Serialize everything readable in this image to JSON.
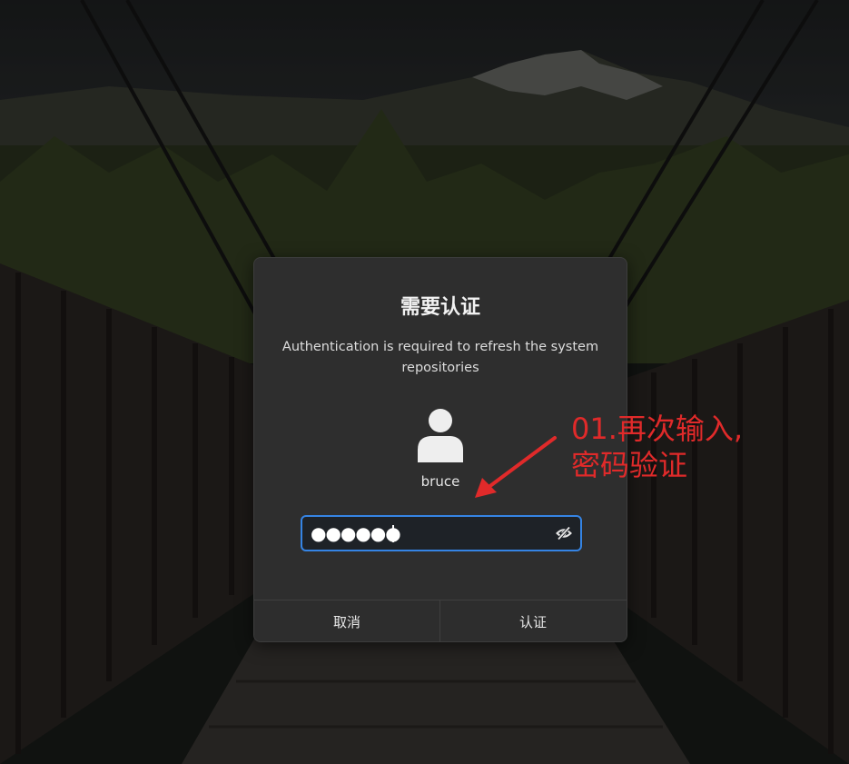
{
  "dialog": {
    "title": "需要认证",
    "message": "Authentication is required to refresh the system repositories",
    "user": {
      "name": "bruce",
      "avatar_icon": "user-avatar-icon"
    },
    "password_field": {
      "masked_value": "●●●●●●",
      "reveal_icon": "eye-slash-icon"
    },
    "buttons": {
      "cancel_label": "取消",
      "confirm_label": "认证"
    }
  },
  "annotation": {
    "text": "01.再次输入,\n密码验证",
    "color": "#e02a2a"
  },
  "colors": {
    "focus_border": "#3584e4",
    "dialog_bg": "#2e2e2e"
  }
}
